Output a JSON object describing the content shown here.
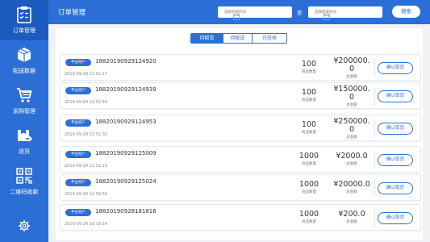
{
  "sidebar": {
    "items": [
      {
        "label": "订单管理",
        "icon": "clipboard-icon"
      },
      {
        "label": "配送数据",
        "icon": "box-icon"
      },
      {
        "label": "采购管理",
        "icon": "cart-icon"
      },
      {
        "label": "退货",
        "icon": "return-icon"
      },
      {
        "label": "二维码收款",
        "icon": "qrcode-icon"
      }
    ],
    "settings_icon": "gear-icon"
  },
  "header": {
    "title": "订单管理",
    "start_placeholder": "选择开始时间",
    "end_placeholder": "选择结束时间",
    "to_label": "至",
    "search_label": "搜索"
  },
  "tabs": [
    "待取货",
    "待配送",
    "已签收"
  ],
  "active_tab": "待取货",
  "orders": [
    {
      "badge": "平台商户",
      "order_no": "18820190929124920",
      "time": "2019-09-29 12:52:17",
      "qty": "100",
      "qty_label": "商品数量",
      "amount_line1": "¥200000.",
      "amount_line2": "0",
      "amount_label": "总金额",
      "action": "确认取货"
    },
    {
      "badge": "平台商户",
      "order_no": "18820190929124939",
      "time": "2019-09-29 12:51:44",
      "qty": "100",
      "qty_label": "商品数量",
      "amount_line1": "¥150000.",
      "amount_line2": "0",
      "amount_label": "总金额",
      "action": "确认取货"
    },
    {
      "badge": "平台商户",
      "order_no": "18820190929124953",
      "time": "2019-09-29 12:51:32",
      "qty": "100",
      "qty_label": "商品数量",
      "amount_line1": "¥250000.",
      "amount_line2": "0",
      "amount_label": "总金额",
      "action": "确认取货"
    },
    {
      "badge": "平台商户",
      "order_no": "18820190929125009",
      "time": "2019-09-29 12:51:13",
      "qty": "1000",
      "qty_label": "商品数量",
      "amount_line1": "¥2000.0",
      "amount_line2": "",
      "amount_label": "总金额",
      "action": "确认取货"
    },
    {
      "badge": "平台商户",
      "order_no": "18820190929125024",
      "time": "2019-09-29 12:50:50",
      "qty": "1000",
      "qty_label": "商品数量",
      "amount_line1": "¥20000.0",
      "amount_line2": "",
      "amount_label": "总金额",
      "action": "确认取货"
    },
    {
      "badge": "平台商户",
      "order_no": "18820190928181816",
      "time": "2019-09-28 18:19:14",
      "qty": "1000",
      "qty_label": "商品数量",
      "amount_line1": "¥200.0",
      "amount_line2": "",
      "amount_label": "总金额",
      "action": "确认取货"
    }
  ],
  "colors": {
    "primary": "#2b6fd6",
    "sidebar_active": "#1c5bbf",
    "background": "#f0f2f6"
  }
}
